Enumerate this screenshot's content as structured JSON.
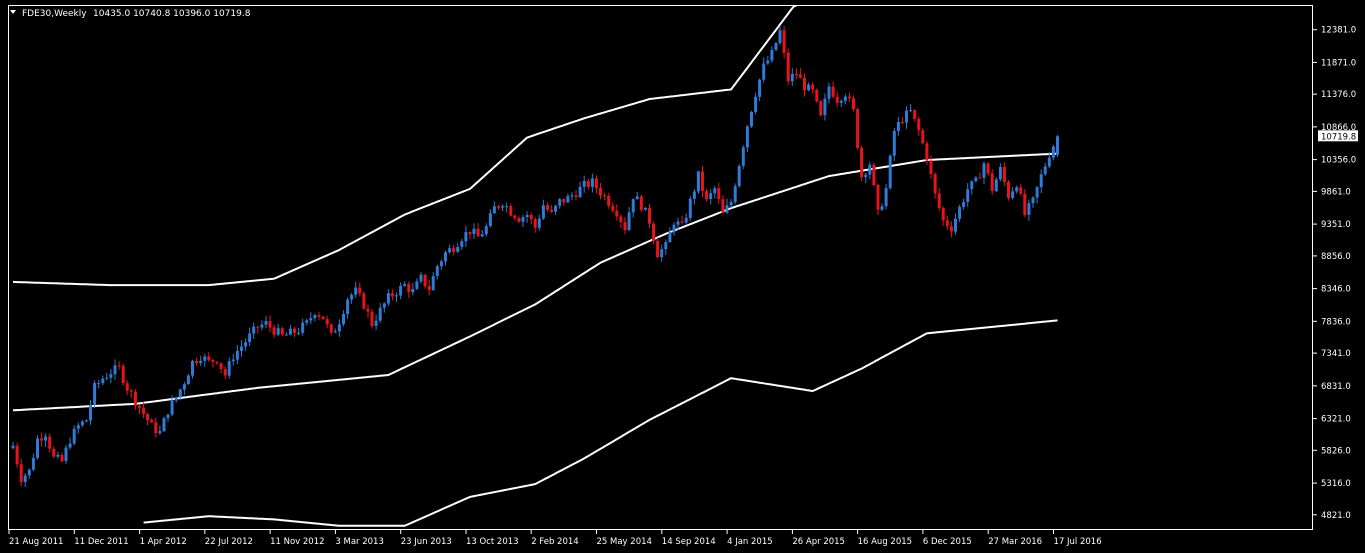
{
  "chart_data": {
    "type": "candlestick",
    "title": "FDE30,Weekly",
    "ohlc_text": "10435.0 10740.8 10396.0 10719.8",
    "last_price": 10719.8,
    "last_price_label": "10719.8",
    "ylim": [
      4600,
      12750
    ],
    "y_ticks": [
      12381.0,
      11871.0,
      11376.0,
      10866.0,
      10356.0,
      9861.0,
      9351.0,
      8856.0,
      8346.0,
      7836.0,
      7341.0,
      6831.0,
      6321.0,
      5826.0,
      5316.0,
      4821.0
    ],
    "y_tick_labels": [
      "12381.0",
      "11871.0",
      "11376.0",
      "10866.0",
      "10356.0",
      "9861.0",
      "9351.0",
      "8856.0",
      "8346.0",
      "7836.0",
      "7341.0",
      "6831.0",
      "6321.0",
      "5826.0",
      "5316.0",
      "4821.0"
    ],
    "x_tick_labels": [
      "21 Aug 2011",
      "11 Dec 2011",
      "1 Apr 2012",
      "22 Jul 2012",
      "11 Nov 2012",
      "3 Mar 2013",
      "23 Jun 2013",
      "13 Oct 2013",
      "2 Feb 2014",
      "25 May 2014",
      "14 Sep 2014",
      "4 Jan 2015",
      "26 Apr 2015",
      "16 Aug 2015",
      "6 Dec 2015",
      "27 Mar 2016",
      "17 Jul 2016"
    ],
    "x_tick_weeks": [
      0,
      16,
      32,
      48,
      64,
      80,
      96,
      112,
      128,
      144,
      160,
      176,
      192,
      208,
      224,
      240,
      256
    ],
    "close_anchors": [
      [
        0,
        5900
      ],
      [
        2,
        5400
      ],
      [
        4,
        5500
      ],
      [
        6,
        6000
      ],
      [
        8,
        6100
      ],
      [
        10,
        5700
      ],
      [
        12,
        5650
      ],
      [
        14,
        6000
      ],
      [
        16,
        6200
      ],
      [
        18,
        6300
      ],
      [
        20,
        6800
      ],
      [
        22,
        6950
      ],
      [
        24,
        7050
      ],
      [
        26,
        7100
      ],
      [
        28,
        6800
      ],
      [
        30,
        6600
      ],
      [
        32,
        6400
      ],
      [
        34,
        6200
      ],
      [
        36,
        6100
      ],
      [
        38,
        6450
      ],
      [
        40,
        6650
      ],
      [
        42,
        6900
      ],
      [
        44,
        7200
      ],
      [
        46,
        7300
      ],
      [
        48,
        7200
      ],
      [
        50,
        7250
      ],
      [
        52,
        7000
      ],
      [
        54,
        7300
      ],
      [
        56,
        7450
      ],
      [
        58,
        7600
      ],
      [
        60,
        7750
      ],
      [
        62,
        7800
      ],
      [
        64,
        7700
      ],
      [
        66,
        7600
      ],
      [
        68,
        7650
      ],
      [
        70,
        7700
      ],
      [
        72,
        7800
      ],
      [
        74,
        8000
      ],
      [
        76,
        7900
      ],
      [
        78,
        7600
      ],
      [
        80,
        7850
      ],
      [
        82,
        8200
      ],
      [
        84,
        8300
      ],
      [
        86,
        8100
      ],
      [
        88,
        7800
      ],
      [
        90,
        8000
      ],
      [
        92,
        8200
      ],
      [
        94,
        8300
      ],
      [
        96,
        8400
      ],
      [
        98,
        8300
      ],
      [
        100,
        8500
      ],
      [
        102,
        8350
      ],
      [
        104,
        8700
      ],
      [
        106,
        8900
      ],
      [
        108,
        9000
      ],
      [
        110,
        9150
      ],
      [
        112,
        9250
      ],
      [
        114,
        9150
      ],
      [
        116,
        9300
      ],
      [
        118,
        9600
      ],
      [
        120,
        9700
      ],
      [
        122,
        9550
      ],
      [
        124,
        9450
      ],
      [
        126,
        9500
      ],
      [
        128,
        9300
      ],
      [
        130,
        9650
      ],
      [
        132,
        9500
      ],
      [
        134,
        9700
      ],
      [
        136,
        9750
      ],
      [
        138,
        9850
      ],
      [
        140,
        9950
      ],
      [
        142,
        10000
      ],
      [
        144,
        9850
      ],
      [
        146,
        9700
      ],
      [
        148,
        9550
      ],
      [
        150,
        9300
      ],
      [
        152,
        9800
      ],
      [
        154,
        9650
      ],
      [
        156,
        9400
      ],
      [
        158,
        8900
      ],
      [
        160,
        9000
      ],
      [
        162,
        9400
      ],
      [
        164,
        9300
      ],
      [
        166,
        9700
      ],
      [
        168,
        10100
      ],
      [
        170,
        9700
      ],
      [
        172,
        9900
      ],
      [
        174,
        9500
      ],
      [
        176,
        9700
      ],
      [
        178,
        10300
      ],
      [
        180,
        10900
      ],
      [
        182,
        11400
      ],
      [
        184,
        11800
      ],
      [
        186,
        12000
      ],
      [
        188,
        12350
      ],
      [
        190,
        11600
      ],
      [
        192,
        11700
      ],
      [
        194,
        11500
      ],
      [
        196,
        11400
      ],
      [
        198,
        11000
      ],
      [
        200,
        11500
      ],
      [
        202,
        11300
      ],
      [
        204,
        11400
      ],
      [
        206,
        11100
      ],
      [
        208,
        10100
      ],
      [
        210,
        10300
      ],
      [
        212,
        9500
      ],
      [
        214,
        9900
      ],
      [
        216,
        10800
      ],
      [
        218,
        11000
      ],
      [
        220,
        11100
      ],
      [
        222,
        10800
      ],
      [
        224,
        10400
      ],
      [
        226,
        9800
      ],
      [
        228,
        9400
      ],
      [
        230,
        9300
      ],
      [
        232,
        9600
      ],
      [
        234,
        9900
      ],
      [
        236,
        10000
      ],
      [
        238,
        10300
      ],
      [
        240,
        9900
      ],
      [
        242,
        10200
      ],
      [
        244,
        9800
      ],
      [
        246,
        10000
      ],
      [
        248,
        9500
      ],
      [
        250,
        9700
      ],
      [
        252,
        10100
      ],
      [
        254,
        10450
      ],
      [
        256,
        10720
      ]
    ],
    "mid_band_anchors": [
      [
        0,
        6450
      ],
      [
        30,
        6550
      ],
      [
        60,
        6800
      ],
      [
        92,
        7000
      ],
      [
        112,
        7600
      ],
      [
        128,
        8100
      ],
      [
        144,
        8750
      ],
      [
        160,
        9200
      ],
      [
        176,
        9600
      ],
      [
        200,
        10100
      ],
      [
        224,
        10350
      ],
      [
        256,
        10450
      ]
    ],
    "upper_band_anchors": [
      [
        0,
        8450
      ],
      [
        24,
        8400
      ],
      [
        48,
        8400
      ],
      [
        64,
        8500
      ],
      [
        80,
        8950
      ],
      [
        96,
        9500
      ],
      [
        112,
        9900
      ],
      [
        126,
        10700
      ],
      [
        140,
        11000
      ],
      [
        156,
        11300
      ],
      [
        176,
        11450
      ],
      [
        192,
        12800
      ]
    ],
    "lower_band_anchors": [
      [
        32,
        4700
      ],
      [
        48,
        4800
      ],
      [
        64,
        4750
      ],
      [
        80,
        4650
      ],
      [
        96,
        4650
      ],
      [
        112,
        5100
      ],
      [
        128,
        5300
      ],
      [
        140,
        5700
      ],
      [
        156,
        6300
      ],
      [
        176,
        6950
      ],
      [
        186,
        6850
      ],
      [
        196,
        6750
      ],
      [
        208,
        7100
      ],
      [
        224,
        7650
      ],
      [
        240,
        7750
      ],
      [
        256,
        7850
      ]
    ],
    "colors": {
      "up": "#2f7bd6",
      "down": "#e8141c",
      "band": "#ffffff",
      "background": "#000000",
      "axis": "#ffffff",
      "label_text": "#ffffff"
    }
  }
}
